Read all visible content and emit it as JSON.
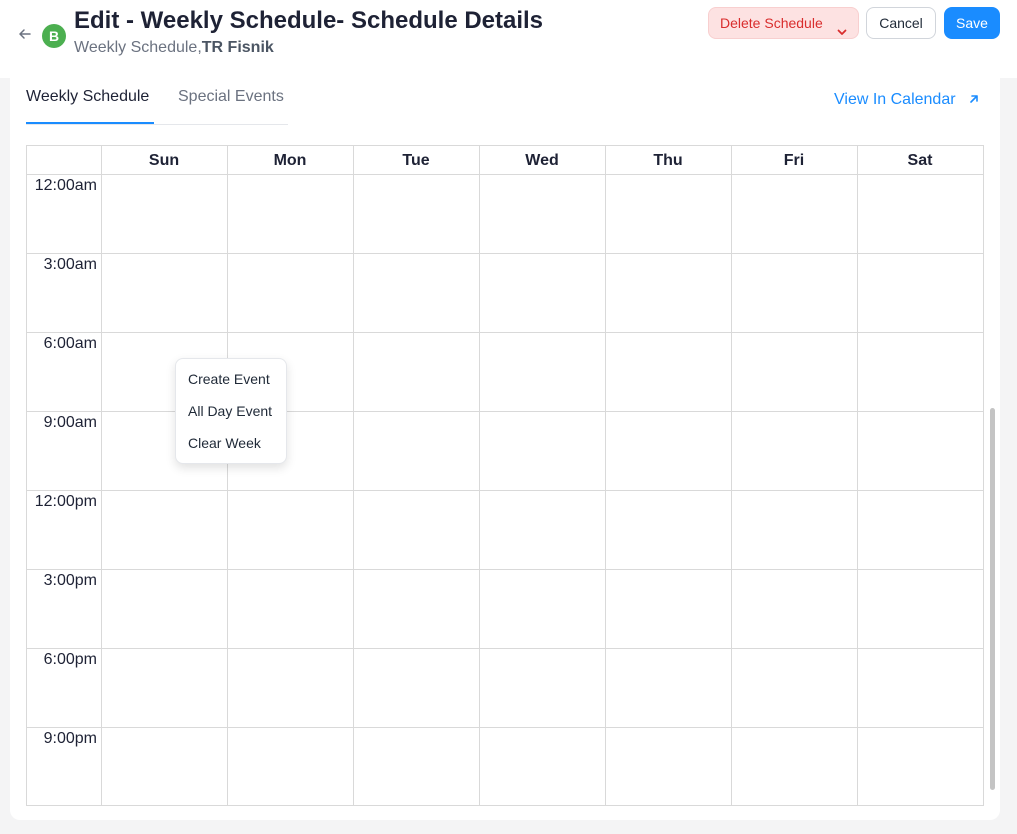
{
  "header": {
    "avatar_letter": "B",
    "title": "Edit - Weekly Schedule- Schedule Details",
    "subtitle_prefix": "Weekly Schedule,",
    "subtitle_name": "TR Fisnik",
    "delete_label": "Delete Schedule",
    "cancel_label": "Cancel",
    "save_label": "Save"
  },
  "tabs": [
    {
      "label": "Weekly Schedule",
      "active": true
    },
    {
      "label": "Special Events",
      "active": false
    }
  ],
  "view_calendar_label": "View In Calendar",
  "calendar": {
    "days": [
      "Sun",
      "Mon",
      "Tue",
      "Wed",
      "Thu",
      "Fri",
      "Sat"
    ],
    "times": [
      "12:00am",
      "3:00am",
      "6:00am",
      "9:00am",
      "12:00pm",
      "3:00pm",
      "6:00pm",
      "9:00pm"
    ]
  },
  "context_menu": {
    "items": [
      "Create Event",
      "All Day Event",
      "Clear Week"
    ]
  },
  "colors": {
    "accent": "#1a8cff",
    "delete_bg": "#fde2e2",
    "delete_text": "#d92d2d",
    "avatar": "#4caf50"
  },
  "icons": {
    "back": "arrow-left-icon",
    "delete_dropdown": "chevron-down-icon",
    "view_calendar": "external-link-icon"
  }
}
